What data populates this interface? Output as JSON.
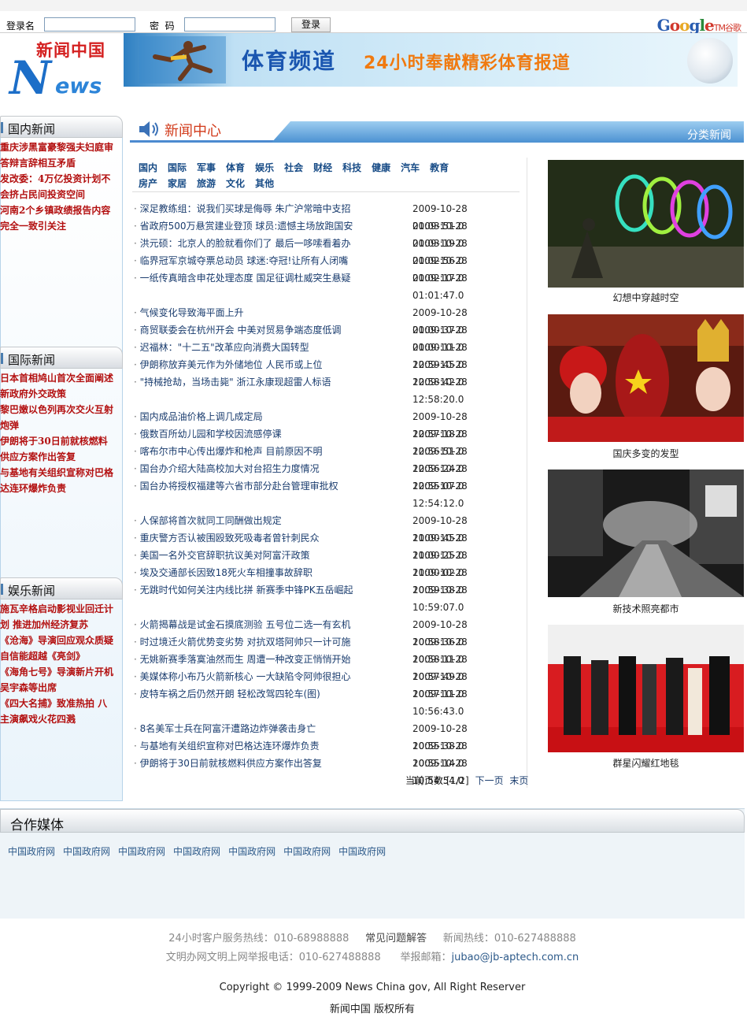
{
  "login": {
    "username_label": "登录名",
    "password_label": "密  码",
    "login_button": "登录",
    "brand": {
      "word": "Google",
      "tm": "TM",
      "cn": "谷歌"
    }
  },
  "header": {
    "logo_cn": "新闻中国",
    "logo_n": "N",
    "logo_ews": "ews",
    "banner_title": "体育频道",
    "banner_slogan": "24小时奉献精彩体育报道"
  },
  "sidebar": {
    "domestic": {
      "title": "国内新闻",
      "items": [
        "重庆涉黑富豪黎强夫妇庭审",
        "答辩言辞相互矛盾",
        "发改委：4万亿投资计划不",
        "会挤占民间投资空间",
        "河南2个乡镇政绩报告内容",
        "完全一致引关注"
      ]
    },
    "international": {
      "title": "国际新闻",
      "items": [
        "日本首相鸠山首次全面阐述",
        "新政府外交政策",
        "黎巴嫩以色列再次交火互射",
        "炮弹",
        "伊朗将于30日前就核燃料",
        "供应方案作出答复",
        "与基地有关组织宣称对巴格",
        "达连环爆炸负责"
      ]
    },
    "entertainment": {
      "title": "娱乐新闻",
      "items": [
        "施瓦辛格启动影视业回迁计",
        "划 推进加州经济复苏",
        "《沧海》导演回应观众质疑",
        "自信能超越《亮剑》",
        "《海角七号》导演新片开机",
        "吴宇森等出席",
        "《四大名捕》致准热拍 八",
        "主演飙戏火花四溅"
      ]
    }
  },
  "center": {
    "title": "新闻中心",
    "tab_label": "分类新闻",
    "categories_row1": [
      "国内",
      "国际",
      "军事",
      "体育",
      "娱乐",
      "社会",
      "财经",
      "科技",
      "健康",
      "汽车",
      "教育"
    ],
    "categories_row2": [
      "房产",
      "家居",
      "旅游",
      "文化",
      "其他"
    ],
    "news": [
      {
        "title": "深足教练组：说我们买球是侮辱 朱广沪常暗中支招",
        "date": "2009-10-28 01:03:51.0"
      },
      {
        "title": "省政府500万悬赏建业登顶 球员:遗憾主场放跑国安",
        "date": "2009-10-28 01:03:19.0"
      },
      {
        "title": "洪元硕：北京人的脸就看你们了 最后一哆嗦看着办",
        "date": "2009-10-28 01:02:56.0"
      },
      {
        "title": "临界冠军京城夺票总动员 球迷:夺冠!让所有人闭嘴",
        "date": "2009-10-28 01:02:17.0"
      },
      {
        "title": "一纸传真暗含申花处理态度 国足征调杜威突生悬疑",
        "date": "2009-10-28 01:01:47.0"
      },
      {
        "title": "气候变化导致海平面上升",
        "date": "2009-10-28 01:00:37.0"
      },
      {
        "title": "商贸联委会在杭州开会 中美对贸易争端态度低调",
        "date": "2009-10-28 01:00:11.0"
      },
      {
        "title": "迟福林：\"十二五\"改革应向消费大国转型",
        "date": "2009-10-28 12:59:45.0"
      },
      {
        "title": "伊朗称放弃美元作为外储地位 人民币或上位",
        "date": "2009-10-28 12:58:42.0"
      },
      {
        "title": "\"持械抢劫，当场击毙\" 浙江永康现超雷人标语",
        "date": "2009-10-28 12:58:20.0"
      },
      {
        "title": "国内成品油价格上调几成定局",
        "date": "2009-10-28 12:57:18.0"
      },
      {
        "title": "俄数百所幼儿园和学校因流感停课",
        "date": "2009-10-28 12:56:51.0"
      },
      {
        "title": "喀布尔市中心传出爆炸和枪声 目前原因不明",
        "date": "2009-10-28 12:56:24.0"
      },
      {
        "title": "国台办介绍大陆高校加大对台招生力度情况",
        "date": "2009-10-28 12:55:07.0"
      },
      {
        "title": "国台办将授权福建等六省市部分赴台管理审批权",
        "date": "2009-10-28 12:54:12.0"
      },
      {
        "title": "人保部将首次就同工同酬做出规定",
        "date": "2009-10-28 11:00:45.0"
      },
      {
        "title": "重庆警方否认被围殴致死吸毒者曾针刺民众",
        "date": "2009-10-28 11:00:25.0"
      },
      {
        "title": "美国一名外交官辞职抗议美对阿富汗政策",
        "date": "2009-10-28 11:00:02.0"
      },
      {
        "title": "埃及交通部长因致18死火车相撞事故辞职",
        "date": "2009-10-28 10:59:38.0"
      },
      {
        "title": "无跳时代如何关注内线比拼 新赛季中锋PK五岳崛起",
        "date": "2009-10-28 10:59:07.0"
      },
      {
        "title": "火箭揭幕战是试金石摸底测验 五号位二选一有玄机",
        "date": "2009-10-28 10:58:36.0"
      },
      {
        "title": "时过境迁火箭优势变劣势 对抗双塔阿帅只一计可施",
        "date": "2009-10-28 10:58:11.0"
      },
      {
        "title": "无姚新赛季落寞油然而生 周遭一种改变正悄悄开始",
        "date": "2009-10-28 10:57:49.0"
      },
      {
        "title": "美媒体称小布乃火箭新核心 一大缺陷令阿帅很担心",
        "date": "2009-10-28 10:57:11.0"
      },
      {
        "title": "皮特车祸之后仍然开朗 轻松改驾四轮车(图)",
        "date": "2009-10-28 10:56:43.0"
      },
      {
        "title": "8名美军士兵在阿富汗遭路边炸弹袭击身亡",
        "date": "2009-10-28 10:55:38.0"
      },
      {
        "title": "与基地有关组织宣称对巴格达连环爆炸负责",
        "date": "2009-10-28 10:55:14.0"
      },
      {
        "title": "伊朗将于30日前就核燃料供应方案作出答复",
        "date": "2009-10-28 10:54:54.0"
      }
    ],
    "pager": {
      "label": "当前页数:[1/2]",
      "next": "下一页",
      "last": "末页"
    }
  },
  "photos": [
    {
      "caption": "幻想中穿越时空"
    },
    {
      "caption": "国庆多变的发型"
    },
    {
      "caption": "新技术照亮都市"
    },
    {
      "caption": "群星闪耀红地毯"
    }
  ],
  "partner": {
    "title": "合作媒体",
    "links": [
      "中国政府网",
      "中国政府网",
      "中国政府网",
      "中国政府网",
      "中国政府网",
      "中国政府网",
      "中国政府网"
    ]
  },
  "footer": {
    "hotline_label": "24小时客户服务热线：010-68988888",
    "faq": "常见问题解答",
    "news_hotline": "新闻热线：010-627488888",
    "report_phone": "文明办网文明上网举报电话：010-627488888",
    "report_email_label": "举报邮箱：",
    "report_email": "jubao@jb-aptech.com.cn",
    "copyright": "Copyright © 1999-2009 News China gov, All Right Reserver",
    "rights": "新闻中国 版权所有"
  }
}
